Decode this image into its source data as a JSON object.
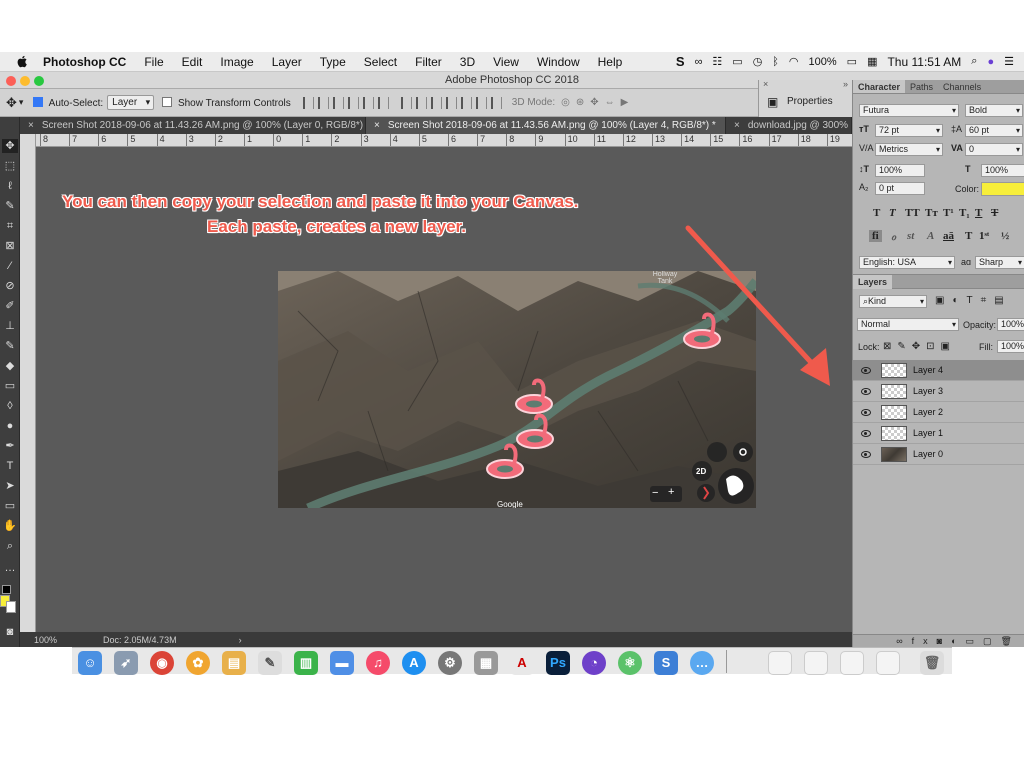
{
  "menubar": {
    "app_name": "Photoshop CC",
    "items": [
      "File",
      "Edit",
      "Image",
      "Layer",
      "Type",
      "Select",
      "Filter",
      "3D",
      "View",
      "Window",
      "Help"
    ],
    "battery": "100%",
    "clock": "Thu 11:51 AM"
  },
  "window": {
    "title": "Adobe Photoshop CC 2018"
  },
  "options_bar": {
    "auto_select_label": "Auto-Select:",
    "auto_select_value": "Layer",
    "show_transform_label": "Show Transform Controls",
    "three_d_mode_label": "3D Mode:"
  },
  "properties_panel": {
    "label": "Properties"
  },
  "doc_tabs": [
    {
      "label": "Screen Shot 2018-09-06 at 11.43.26 AM.png @ 100% (Layer 0, RGB/8*)"
    },
    {
      "label": "Screen Shot 2018-09-06 at 11.43.56 AM.png @ 100% (Layer 4, RGB/8*) *"
    },
    {
      "label": "download.jpg @ 300% ("
    }
  ],
  "ruler_marks": [
    "8",
    "7",
    "6",
    "5",
    "4",
    "3",
    "2",
    "1",
    "0",
    "1",
    "2",
    "3",
    "4",
    "5",
    "6",
    "7",
    "8",
    "9",
    "10",
    "11",
    "12",
    "13",
    "14",
    "15",
    "16",
    "17",
    "18",
    "19"
  ],
  "callout": {
    "line1": "You can then copy your selection and paste it into your Canvas.",
    "line2": "Each paste, creates a new layer."
  },
  "map_overlay": {
    "label_top": "Hollway Tank",
    "label_google": "Google",
    "button_2d": "2D",
    "zoom_minus": "−",
    "zoom_plus": "+"
  },
  "status_bar": {
    "zoom": "100%",
    "doc_size": "Doc: 2.05M/4.73M"
  },
  "character_panel": {
    "tabs": [
      "Character",
      "Paths",
      "Channels"
    ],
    "font_family": "Futura",
    "font_style": "Bold",
    "font_size": "72 pt",
    "leading": "60 pt",
    "kerning": "Metrics",
    "tracking": "0",
    "vertical_scale": "100%",
    "horizontal_scale": "100%",
    "baseline_shift": "0 pt",
    "color_label": "Color:",
    "color_value": "#f7ee3a",
    "language": "English: USA",
    "antialias_label": "aɑ",
    "antialias": "Sharp"
  },
  "layers_panel": {
    "title": "Layers",
    "kind_filter": "Kind",
    "blend_mode": "Normal",
    "opacity_label": "Opacity:",
    "opacity": "100%",
    "lock_label": "Lock:",
    "fill_label": "Fill:",
    "fill": "100%",
    "layers": [
      {
        "name": "Layer 4",
        "selected": true
      },
      {
        "name": "Layer 3",
        "selected": false
      },
      {
        "name": "Layer 2",
        "selected": false
      },
      {
        "name": "Layer 1",
        "selected": false
      },
      {
        "name": "Layer 0",
        "selected": false
      }
    ]
  },
  "colors": {
    "accent_red": "#ef5a4c",
    "foreground_swatch": "#f7ee3a"
  }
}
